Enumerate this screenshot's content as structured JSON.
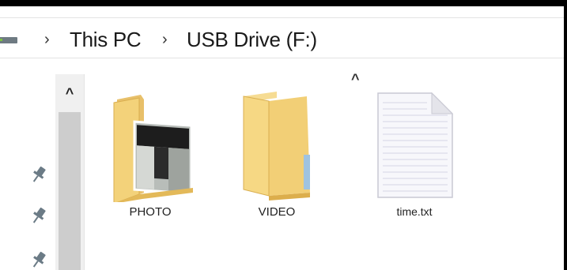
{
  "breadcrumb": {
    "separator": "›",
    "items": [
      "This PC",
      "USB Drive (F:)"
    ]
  },
  "items": [
    {
      "name": "PHOTO",
      "type": "folder-with-photo"
    },
    {
      "name": "VIDEO",
      "type": "folder"
    },
    {
      "name": "time.txt",
      "type": "text-file"
    }
  ],
  "icons": {
    "drive": "drive-icon",
    "pin": "pin-icon",
    "scroll_up": "chevron-up-icon",
    "sort": "sort-caret-icon"
  },
  "glyphs": {
    "scroll_up": "^",
    "sort_caret": "^"
  },
  "colors": {
    "folder": "#f3d27a",
    "folder_shadow": "#d9ae4f",
    "window_frame": "#000000",
    "scrollbar_thumb": "#cdcdcd"
  }
}
